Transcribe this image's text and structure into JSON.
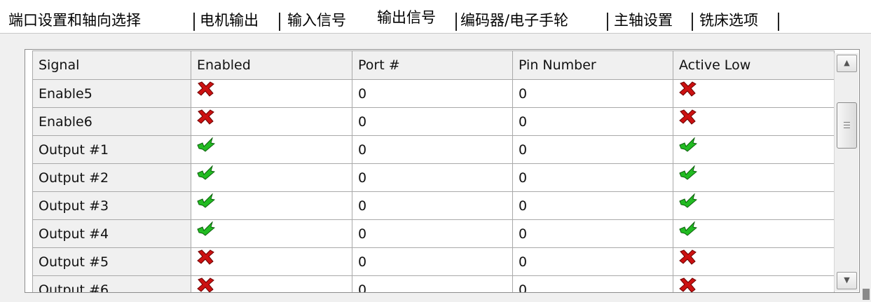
{
  "tabs": [
    {
      "label": "端口设置和轴向选择"
    },
    {
      "label": "电机输出"
    },
    {
      "label": "输入信号"
    },
    {
      "label": "输出信号",
      "active": true
    },
    {
      "label": "编码器/电子手轮"
    },
    {
      "label": "主轴设置"
    },
    {
      "label": "铣床选项"
    }
  ],
  "grid": {
    "columns": [
      "Signal",
      "Enabled",
      "Port #",
      "Pin Number",
      "Active Low"
    ],
    "rows": [
      {
        "signal": "Enable5",
        "enabled": "x",
        "port": "0",
        "pin": "0",
        "active_low": "x"
      },
      {
        "signal": "Enable6",
        "enabled": "x",
        "port": "0",
        "pin": "0",
        "active_low": "x"
      },
      {
        "signal": "Output #1",
        "enabled": "check",
        "port": "0",
        "pin": "0",
        "active_low": "check"
      },
      {
        "signal": "Output #2",
        "enabled": "check",
        "port": "0",
        "pin": "0",
        "active_low": "check"
      },
      {
        "signal": "Output #3",
        "enabled": "check",
        "port": "0",
        "pin": "0",
        "active_low": "check"
      },
      {
        "signal": "Output #4",
        "enabled": "check",
        "port": "0",
        "pin": "0",
        "active_low": "check"
      },
      {
        "signal": "Output #5",
        "enabled": "x",
        "port": "0",
        "pin": "0",
        "active_low": "x"
      },
      {
        "signal": "Output #6",
        "enabled": "x",
        "port": "0",
        "pin": "0",
        "active_low": "x"
      }
    ]
  },
  "icons": {
    "x": {
      "name": "red-x-icon",
      "color": "#cc1111"
    },
    "check": {
      "name": "green-check-icon",
      "color": "#22bb22"
    }
  },
  "colors": {
    "accent_check": "#22bb22",
    "accent_x": "#cc1111"
  }
}
